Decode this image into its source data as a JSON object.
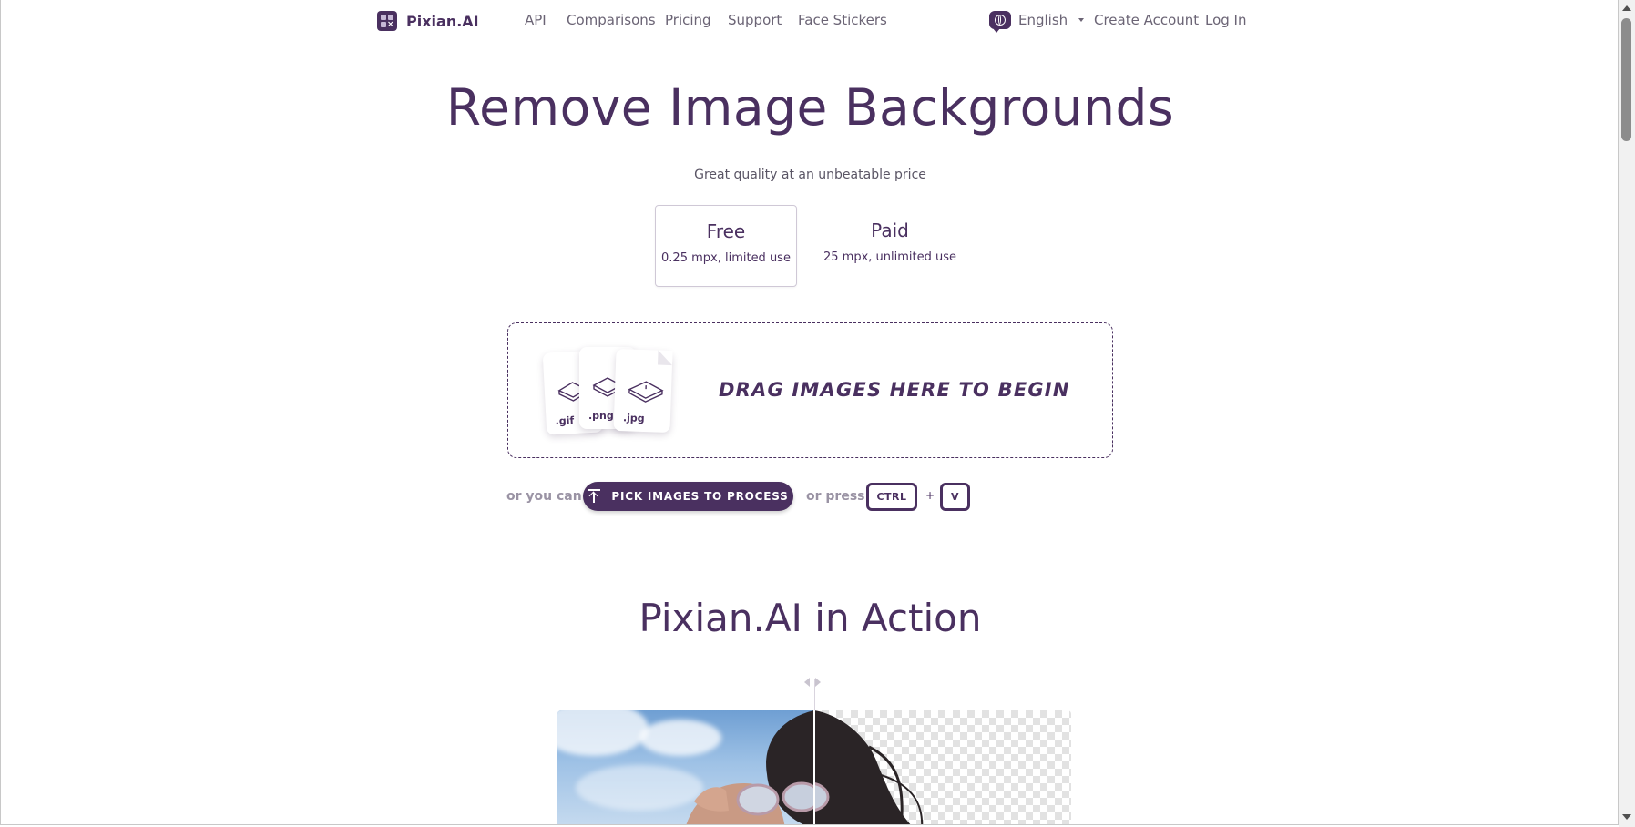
{
  "nav": {
    "brand": "Pixian.AI",
    "links": [
      "API",
      "Comparisons",
      "Pricing",
      "Support",
      "Face Stickers"
    ],
    "language": "English",
    "create_account": "Create Account",
    "log_in": "Log In"
  },
  "hero": {
    "title": "Remove Image Backgrounds",
    "subtitle": "Great quality at an unbeatable price"
  },
  "plans": [
    {
      "name": "Free",
      "desc": "0.25 mpx, limited use",
      "selected": true
    },
    {
      "name": "Paid",
      "desc": "25 mpx, unlimited use",
      "selected": false
    }
  ],
  "dropzone": {
    "text": "DRAG IMAGES HERE TO BEGIN",
    "file_types": [
      ".gif",
      ".png",
      ".jpg"
    ]
  },
  "actions": {
    "or_you_can": "or you can",
    "pick_button": "PICK IMAGES TO PROCESS",
    "or_press": "or press",
    "key1": "CTRL",
    "plus": "+",
    "key2": "V"
  },
  "section": {
    "title": "Pixian.AI in Action"
  },
  "colors": {
    "brand": "#4a3060",
    "text_muted": "#6b6475"
  }
}
